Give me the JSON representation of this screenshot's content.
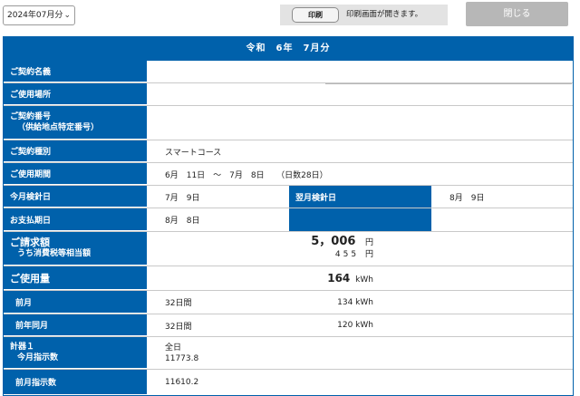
{
  "toolbar": {
    "month_value": "2024年07月分",
    "print_label": "印刷",
    "print_note": "印刷画面が開きます。",
    "close_label": "閉じる"
  },
  "sheet": {
    "title": "令和　6年　7月分",
    "labels": {
      "contract_name": "ご契約名義",
      "location": "ご使用場所",
      "contract_no": "ご契約番号",
      "contract_no_sub": "（供給地点特定番号）",
      "contract_type": "ご契約種別",
      "period": "ご使用期間",
      "meter_date": "今月検針日",
      "next_meter_date": "翌月検針日",
      "pay_date": "お支払期日",
      "billing": "ご請求額",
      "billing_sub": "うち消費税等相当額",
      "usage": "ご使用量",
      "prev_month": "前月",
      "prev_year": "前年同月",
      "meter1": "計器１",
      "meter1_sub": "今月指示数",
      "prev_reading": "前月指示数"
    },
    "values": {
      "contract_type": "スマートコース",
      "period": "6月　11日　～　7月　8日　　（日数28日）",
      "meter_date": "7月　9日",
      "next_meter_date": "8月　9日",
      "pay_date": "8月　8日",
      "billing_amount": "5，006",
      "billing_unit": "円",
      "tax_amount": "455",
      "tax_unit": "円",
      "usage_amount": "164",
      "usage_unit": "kWh",
      "prev_month_days": "32日間",
      "prev_month_usage": "134 kWh",
      "prev_year_days": "32日間",
      "prev_year_usage": "120 kWh",
      "meter1_type": "全日",
      "meter1_reading": "11773.8",
      "prev_reading": "11610.2"
    }
  }
}
